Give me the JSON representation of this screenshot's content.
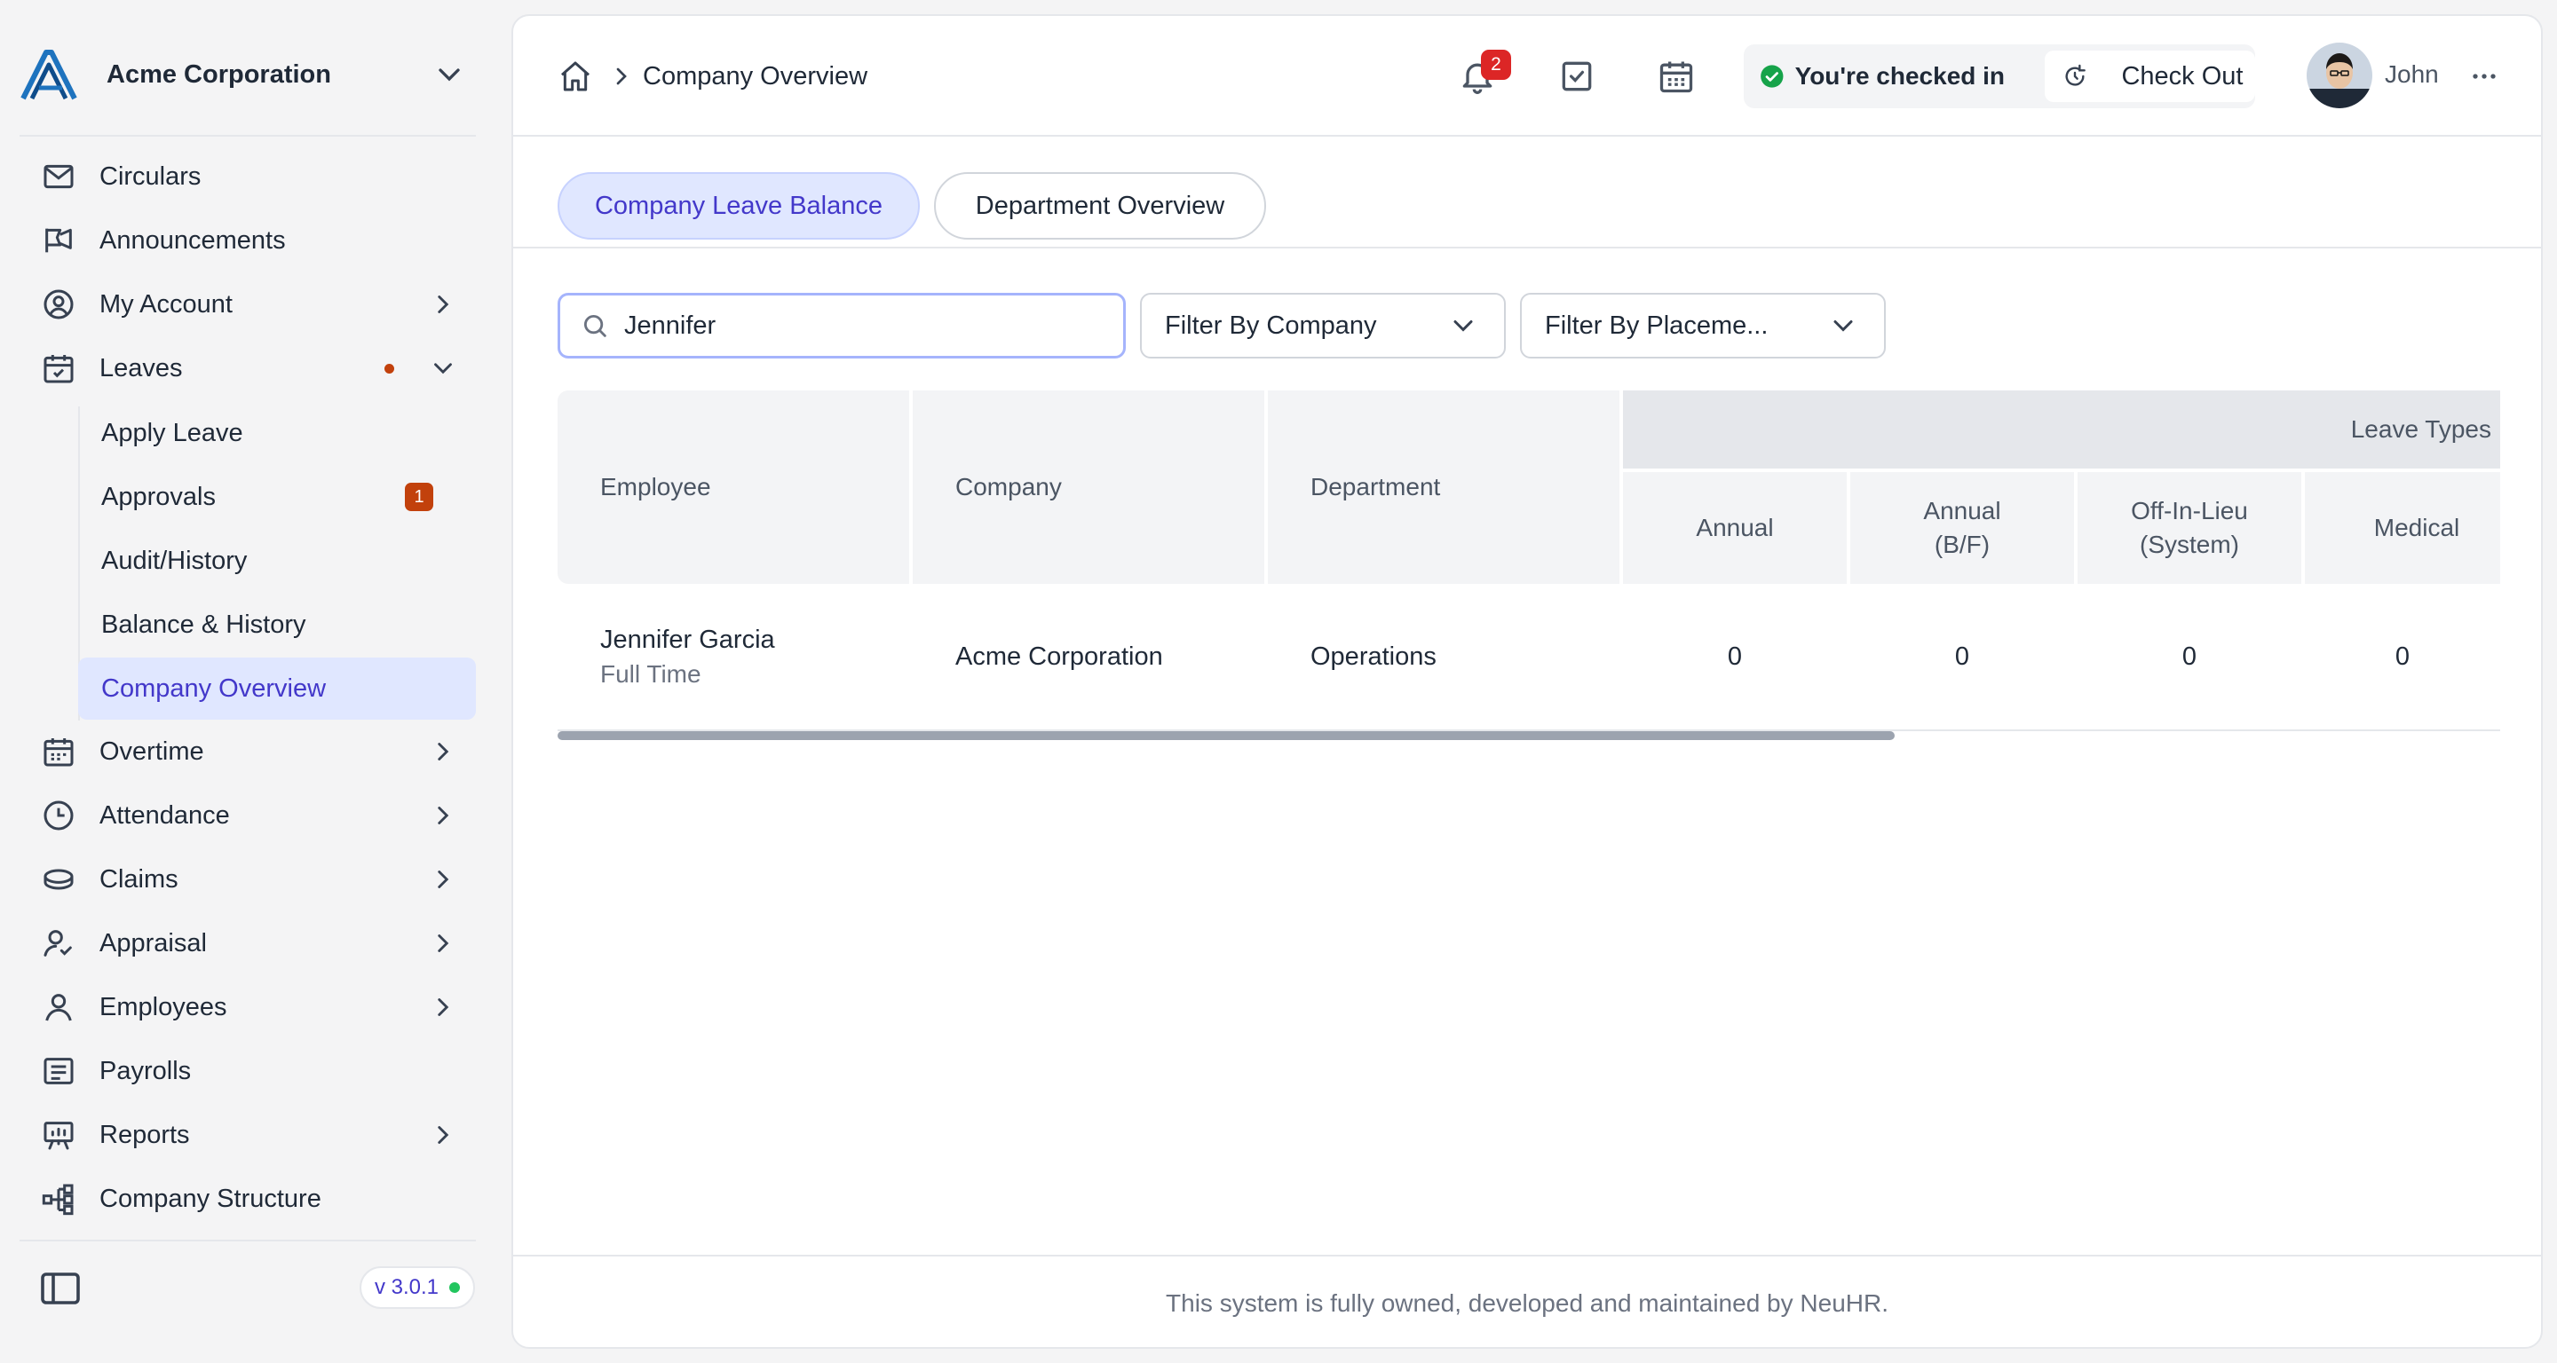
{
  "sidebar": {
    "company_name": "Acme Corporation",
    "items": [
      {
        "label": "Circulars",
        "icon": "mail-icon"
      },
      {
        "label": "Announcements",
        "icon": "megaphone-icon"
      },
      {
        "label": "My Account",
        "icon": "user-circle-icon"
      },
      {
        "label": "Leaves",
        "icon": "calendar-check-icon"
      },
      {
        "label": "Overtime",
        "icon": "calendar-icon"
      },
      {
        "label": "Attendance",
        "icon": "clock-icon"
      },
      {
        "label": "Claims",
        "icon": "coins-icon"
      },
      {
        "label": "Appraisal",
        "icon": "user-check-icon"
      },
      {
        "label": "Employees",
        "icon": "user-icon"
      },
      {
        "label": "Payrolls",
        "icon": "receipt-icon"
      },
      {
        "label": "Reports",
        "icon": "presentation-icon"
      },
      {
        "label": "Company Structure",
        "icon": "org-chart-icon"
      }
    ],
    "leaves_sub": [
      {
        "label": "Apply Leave"
      },
      {
        "label": "Approvals",
        "badge": "1"
      },
      {
        "label": "Audit/History"
      },
      {
        "label": "Balance & History"
      },
      {
        "label": "Company Overview"
      }
    ],
    "version": "v 3.0.1"
  },
  "topbar": {
    "breadcrumb_current": "Company Overview",
    "notification_count": "2",
    "checkin_status": "You're checked in",
    "checkout_label": "Check Out",
    "user_name": "John"
  },
  "tabs": [
    {
      "label": "Company Leave Balance",
      "active": true
    },
    {
      "label": "Department Overview",
      "active": false
    }
  ],
  "filters": {
    "search_value": "Jennifer",
    "company_placeholder": "Filter By Company",
    "placement_placeholder": "Filter By Placeme..."
  },
  "table": {
    "headers": {
      "employee": "Employee",
      "company": "Company",
      "department": "Department",
      "group": "Leave Types",
      "annual": "Annual",
      "annual_bf_1": "Annual",
      "annual_bf_2": "(B/F)",
      "offinlieu_1": "Off-In-Lieu",
      "offinlieu_2": "(System)",
      "medical": "Medical"
    },
    "rows": [
      {
        "employee_name": "Jennifer Garcia",
        "employment_type": "Full Time",
        "company": "Acme Corporation",
        "department": "Operations",
        "annual": "0",
        "annual_bf": "0",
        "off_in_lieu": "0",
        "medical": "0"
      }
    ]
  },
  "footer": {
    "text": "This system is fully owned, developed and maintained by NeuHR."
  },
  "colors": {
    "accent": "#4338ca",
    "active_bg": "#e0e7ff",
    "badge_red": "#c2410c",
    "notif_red": "#dc2626",
    "status_green": "#16a34a"
  }
}
